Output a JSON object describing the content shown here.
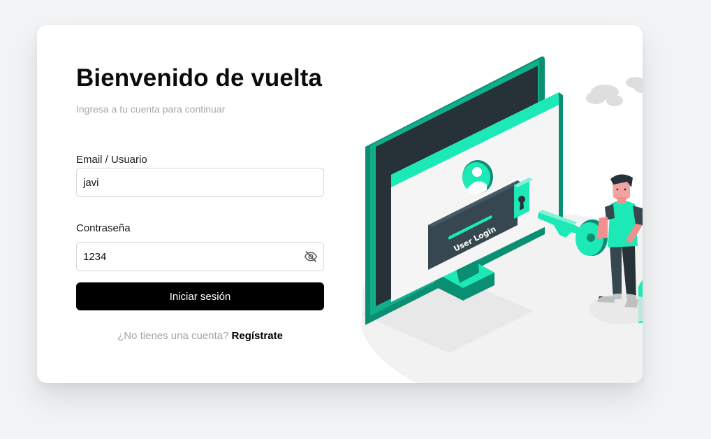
{
  "login": {
    "title": "Bienvenido de vuelta",
    "subtitle": "Ingresa a tu cuenta para continuar",
    "email_label": "Email / Usuario",
    "email_value": "javi",
    "password_label": "Contraseña",
    "password_value": "1234",
    "password_toggle_icon": "eye-off-icon",
    "submit_label": "Iniciar sesión",
    "signup_prompt": "¿No tienes una cuenta?",
    "signup_link": "Regístrate"
  },
  "illustration": {
    "screen_text": "User Login",
    "colors": {
      "accent": "#1de9b6",
      "accent_dark": "#0a8f72",
      "monitor_dark": "#263238",
      "card_bg": "#ffffff",
      "page_bg": "#f2f3f5"
    }
  }
}
